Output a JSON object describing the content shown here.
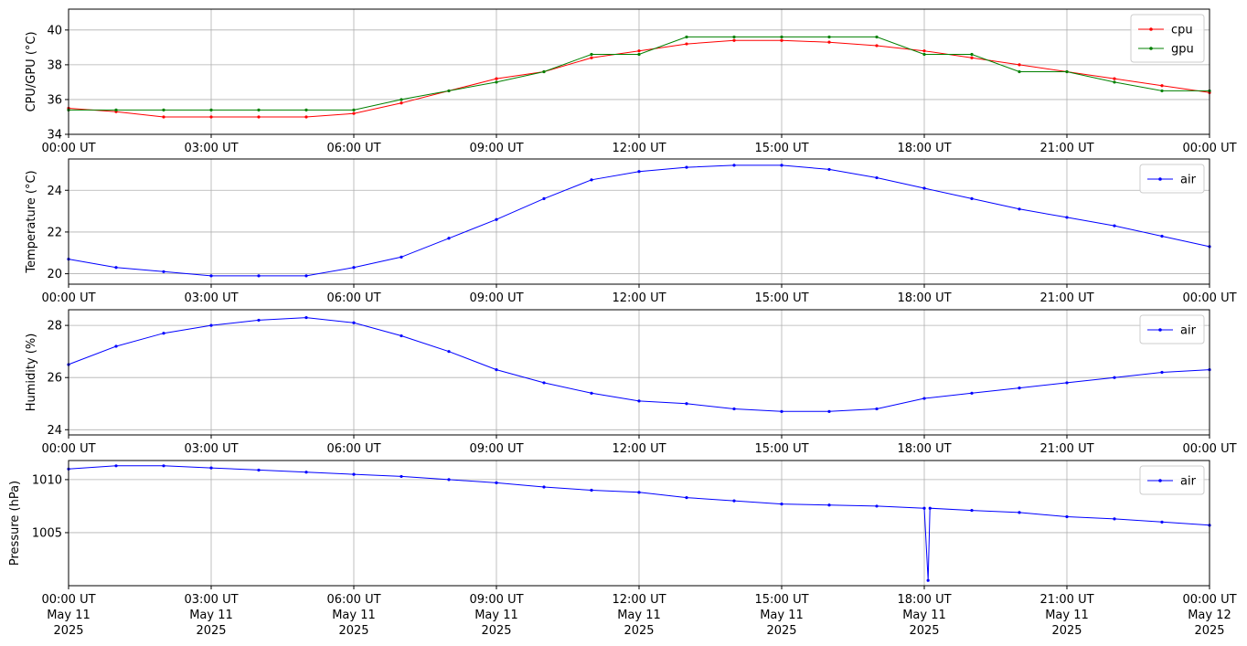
{
  "chart_data": [
    {
      "type": "line",
      "ylabel": "CPU/GPU (°C)",
      "ylim": [
        34,
        41.2
      ],
      "yticks": [
        34,
        36,
        38,
        40
      ],
      "grid": true,
      "legend_position": "top-right",
      "series": [
        {
          "name": "cpu",
          "color": "#ff0000",
          "x": [
            0,
            1,
            2,
            3,
            4,
            5,
            6,
            7,
            8,
            9,
            10,
            11,
            12,
            13,
            14,
            15,
            16,
            17,
            18,
            19,
            20,
            21,
            22,
            23,
            24
          ],
          "y": [
            35.5,
            35.3,
            35.0,
            35.0,
            35.0,
            35.0,
            35.2,
            35.8,
            36.5,
            37.2,
            37.6,
            38.4,
            38.8,
            39.2,
            39.4,
            39.4,
            39.3,
            39.1,
            38.8,
            38.4,
            38.0,
            37.6,
            37.2,
            36.8,
            36.4
          ]
        },
        {
          "name": "gpu",
          "color": "#008000",
          "x": [
            0,
            1,
            2,
            3,
            4,
            5,
            6,
            7,
            8,
            9,
            10,
            11,
            12,
            13,
            14,
            15,
            16,
            17,
            18,
            19,
            20,
            21,
            22,
            23,
            24
          ],
          "y": [
            35.4,
            35.4,
            35.4,
            35.4,
            35.4,
            35.4,
            35.4,
            36.0,
            36.5,
            37.0,
            37.6,
            38.6,
            38.6,
            39.6,
            39.6,
            39.6,
            39.6,
            39.6,
            38.6,
            38.6,
            37.6,
            37.6,
            37.0,
            36.5,
            36.5
          ]
        }
      ]
    },
    {
      "type": "line",
      "ylabel": "Temperature (°C)",
      "ylim": [
        19.5,
        25.5
      ],
      "yticks": [
        20,
        22,
        24
      ],
      "grid": true,
      "legend_position": "top-right",
      "series": [
        {
          "name": "air",
          "color": "#0000ff",
          "x": [
            0,
            1,
            2,
            3,
            4,
            5,
            6,
            7,
            8,
            9,
            10,
            11,
            12,
            13,
            14,
            15,
            16,
            17,
            18,
            19,
            20,
            21,
            22,
            23,
            24
          ],
          "y": [
            20.7,
            20.3,
            20.1,
            19.9,
            19.9,
            19.9,
            20.3,
            20.8,
            21.7,
            22.6,
            23.6,
            24.5,
            24.9,
            25.1,
            25.2,
            25.2,
            25.0,
            24.6,
            24.1,
            23.6,
            23.1,
            22.7,
            22.3,
            21.8,
            21.3
          ]
        }
      ]
    },
    {
      "type": "line",
      "ylabel": "Humidity (%)",
      "ylim": [
        23.8,
        28.6
      ],
      "yticks": [
        24,
        26,
        28
      ],
      "grid": true,
      "legend_position": "top-right",
      "series": [
        {
          "name": "air",
          "color": "#0000ff",
          "x": [
            0,
            1,
            2,
            3,
            4,
            5,
            6,
            7,
            8,
            9,
            10,
            11,
            12,
            13,
            14,
            15,
            16,
            17,
            18,
            19,
            20,
            21,
            22,
            23,
            24
          ],
          "y": [
            26.5,
            27.2,
            27.7,
            28.0,
            28.2,
            28.3,
            28.1,
            27.6,
            27.0,
            26.3,
            25.8,
            25.4,
            25.1,
            25.0,
            24.8,
            24.7,
            24.7,
            24.8,
            25.2,
            25.4,
            25.6,
            25.8,
            26.0,
            26.2,
            26.3
          ]
        }
      ]
    },
    {
      "type": "line",
      "ylabel": "Pressure (hPa)",
      "ylim": [
        1000,
        1011.8
      ],
      "yticks": [
        1005,
        1010
      ],
      "grid": true,
      "legend_position": "top-right",
      "series": [
        {
          "name": "air",
          "color": "#0000ff",
          "x": [
            0,
            1,
            2,
            3,
            4,
            5,
            6,
            7,
            8,
            9,
            10,
            11,
            12,
            13,
            14,
            15,
            16,
            17,
            18,
            18.08,
            18.12,
            19,
            20,
            21,
            22,
            23,
            24
          ],
          "y": [
            1011.0,
            1011.3,
            1011.3,
            1011.1,
            1010.9,
            1010.7,
            1010.5,
            1010.3,
            1010.0,
            1009.7,
            1009.3,
            1009.0,
            1008.8,
            1008.3,
            1008.0,
            1007.7,
            1007.6,
            1007.5,
            1007.3,
            1000.5,
            1007.3,
            1007.1,
            1006.9,
            1006.5,
            1006.3,
            1006.0,
            1005.7
          ]
        }
      ]
    }
  ],
  "x_axis": {
    "range_hours": [
      0,
      24
    ],
    "ticks": [
      0,
      3,
      6,
      9,
      12,
      15,
      18,
      21,
      24
    ],
    "tick_labels": [
      "00:00 UT",
      "03:00 UT",
      "06:00 UT",
      "09:00 UT",
      "12:00 UT",
      "15:00 UT",
      "18:00 UT",
      "21:00 UT",
      "00:00 UT"
    ],
    "date_labels": [
      "May 11",
      "May 11",
      "May 11",
      "May 11",
      "May 11",
      "May 11",
      "May 11",
      "May 11",
      "May 12"
    ],
    "year_labels": [
      "2025",
      "2025",
      "2025",
      "2025",
      "2025",
      "2025",
      "2025",
      "2025",
      "2025"
    ]
  }
}
